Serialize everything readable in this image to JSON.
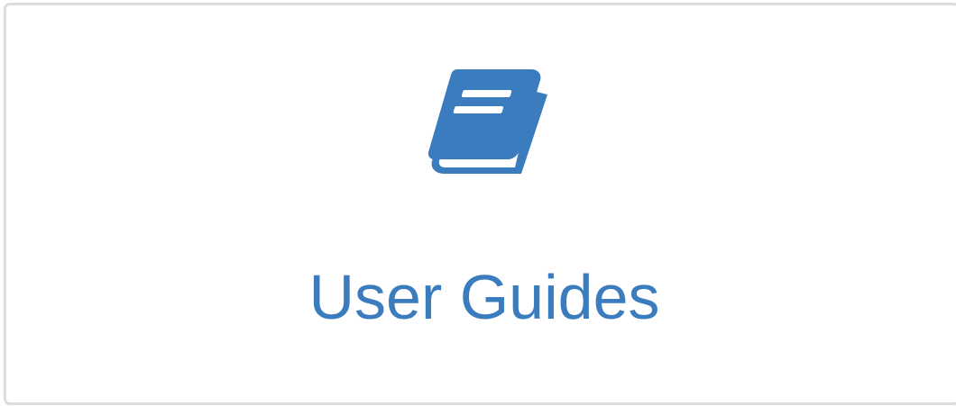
{
  "card": {
    "label": "User Guides",
    "icon": "book-icon",
    "accent_color": "#3a7cbd",
    "border_color": "#dcdcdc"
  }
}
